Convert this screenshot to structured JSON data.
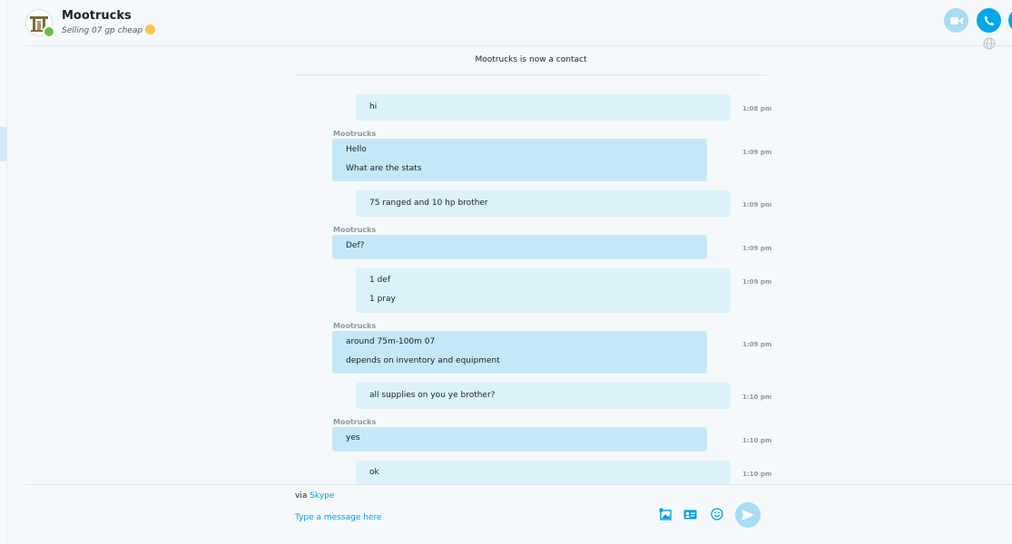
{
  "header": {
    "contact_name": "Mootrucks",
    "mood_message": "Selling 07 gp cheap"
  },
  "notice": "Mootrucks is now a contact",
  "messages": [
    {
      "from": "me",
      "lines": [
        "hi"
      ],
      "time": "1:08 pm"
    },
    {
      "from": "Mootrucks",
      "lines": [
        "Hello",
        "What are the stats"
      ],
      "time": "1:09 pm"
    },
    {
      "from": "me",
      "lines": [
        "75 ranged and 10 hp brother"
      ],
      "time": "1:09 pm"
    },
    {
      "from": "Mootrucks",
      "lines": [
        "Def?"
      ],
      "time": "1:09 pm"
    },
    {
      "from": "me",
      "lines": [
        "1 def",
        "1 pray"
      ],
      "time": "1:09 pm"
    },
    {
      "from": "Mootrucks",
      "lines": [
        "around 75m-100m 07",
        "depends on inventory and equipment"
      ],
      "time": "1:09 pm"
    },
    {
      "from": "me",
      "lines": [
        "all supplies on you ye brother?"
      ],
      "time": "1:10 pm"
    },
    {
      "from": "Mootrucks",
      "lines": [
        "yes"
      ],
      "time": "1:10 pm"
    },
    {
      "from": "me",
      "lines": [
        "ok"
      ],
      "time": "1:10 pm"
    }
  ],
  "composer": {
    "via_prefix": "via",
    "via_service": "Skype",
    "placeholder": "Type a message here"
  },
  "icons": [
    "video-call-icon",
    "audio-call-icon",
    "globe-icon",
    "image-icon",
    "contact-card-icon",
    "emoji-icon",
    "send-icon"
  ],
  "colors": {
    "accent": "#00a8e8",
    "bubble_outgoing": "#dbf2fb",
    "bubble_incoming": "#c5e8f8",
    "presence_online": "#6bbf3a"
  }
}
